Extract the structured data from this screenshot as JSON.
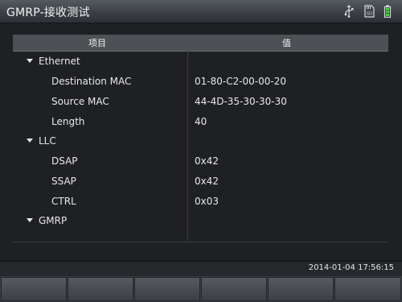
{
  "window": {
    "title": "GMRP-接收测试"
  },
  "status_icons": [
    {
      "name": "usb-icon"
    },
    {
      "name": "sd-card-icon",
      "label": "SD"
    },
    {
      "name": "battery-icon",
      "color": "#3fdc3f"
    }
  ],
  "table": {
    "headers": {
      "item": "项目",
      "value": "值"
    },
    "rows": [
      {
        "type": "group",
        "label": "Ethernet",
        "value": ""
      },
      {
        "type": "field",
        "label": "Destination MAC",
        "value": "01-80-C2-00-00-20"
      },
      {
        "type": "field",
        "label": "Source MAC",
        "value": "44-4D-35-30-30-30"
      },
      {
        "type": "field",
        "label": "Length",
        "value": "40"
      },
      {
        "type": "group",
        "label": "LLC",
        "value": ""
      },
      {
        "type": "field",
        "label": "DSAP",
        "value": "0x42"
      },
      {
        "type": "field",
        "label": "SSAP",
        "value": "0x42"
      },
      {
        "type": "field",
        "label": "CTRL",
        "value": "0x03"
      },
      {
        "type": "group",
        "label": "GMRP",
        "value": ""
      }
    ]
  },
  "footer": {
    "timestamp": "2014-01-04 17:56:15"
  },
  "softkeys": [
    "",
    "",
    "",
    "",
    "",
    ""
  ]
}
